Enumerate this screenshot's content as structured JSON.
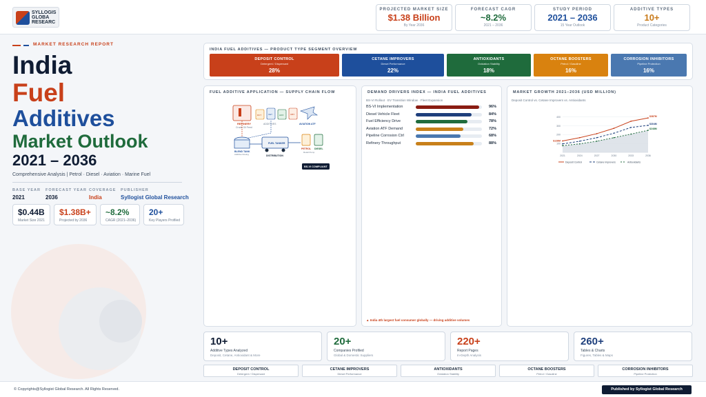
{
  "logo": {
    "line1": "SYLLOGIS",
    "line2": "GLOBA",
    "line3": "RESEARC"
  },
  "header_stats": [
    {
      "label": "PROJECTED MARKET SIZE",
      "value": "$1.38 Billion",
      "sub": "By Year 2036",
      "color": "#c8401a"
    },
    {
      "label": "FORECAST CAGR",
      "value": "~8.2%",
      "sub": "2021 – 2036",
      "color": "#1f6b3c"
    },
    {
      "label": "STUDY PERIOD",
      "value": "2021 – 2036",
      "sub": "15 Year Outlook",
      "color": "#1e4f9c"
    },
    {
      "label": "ADDITIVE TYPES",
      "value": "10+",
      "sub": "Product Categories",
      "color": "#c87a1a"
    }
  ],
  "hero": {
    "tag": "MARKET RESEARCH REPORT",
    "line1": "India",
    "line2": "Fuel",
    "line3": "Additives",
    "line4": "Market Outlook",
    "line5": "2021 – 2036",
    "subtitle": "Comprehensive Analysis  |  Petrol · Diesel · Aviation · Marine Fuel"
  },
  "meta": [
    {
      "label": "BASE YEAR",
      "value": "2021",
      "color": "#0f1c33"
    },
    {
      "label": "FORECAST YEAR",
      "value": "2036",
      "color": "#0f1c33"
    },
    {
      "label": "COVERAGE",
      "value": "India",
      "color": "#c8401a"
    },
    {
      "label": "PUBLISHER",
      "value": "Syllogist Global Research",
      "color": "#1e4f9c"
    }
  ],
  "mini_cards": [
    {
      "value": "$0.44B",
      "sub": "Market Size 2021",
      "color": "#0f1c33"
    },
    {
      "value": "$1.38B+",
      "sub": "Projected by 2036",
      "color": "#c8401a"
    },
    {
      "value": "~8.2%",
      "sub": "CAGR (2021–2036)",
      "color": "#1f6b3c"
    },
    {
      "value": "20+",
      "sub": "Key Players Profiled",
      "color": "#1e4f9c"
    }
  ],
  "segments": {
    "title": "INDIA FUEL ADDITIVES — PRODUCT TYPE SEGMENT OVERVIEW",
    "items": [
      {
        "name": "DEPOSIT CONTROL",
        "desc": "Detergent / Dispersant",
        "pct": "28%",
        "color": "#c8401a"
      },
      {
        "name": "CETANE IMPROVERS",
        "desc": "Diesel Performance",
        "pct": "22%",
        "color": "#1e4f9c"
      },
      {
        "name": "ANTIOXIDANTS",
        "desc": "Oxidation Stability",
        "pct": "18%",
        "color": "#1f6b3c"
      },
      {
        "name": "OCTANE BOOSTERS",
        "desc": "Petrol / Gasoline",
        "pct": "16%",
        "color": "#d9820f"
      },
      {
        "name": "CORROSION INHIBITORS",
        "desc": "Pipeline Protection",
        "pct": "16%",
        "color": "#4a78b0"
      }
    ]
  },
  "supply_chain": {
    "title": "FUEL ADDITIVE APPLICATION — SUPPLY CHAIN FLOW",
    "refinery": "REFINERY",
    "refinery_sub": "Crude Oil Feed",
    "additives": "ADDITIVES",
    "aviation": "AVIATION ATF",
    "blend": "BLEND TANK",
    "blend_sub": "Additive Dosing",
    "tanker": "FUEL TANKER",
    "distribution": "DISTRIBUTION",
    "petrol": "PETROL",
    "diesel": "DIESEL",
    "retail": "Retail Pump",
    "badge": "BS-VI COMPLIANT",
    "drums": [
      "DCT",
      "CET",
      "AOX",
      "OBT"
    ]
  },
  "drivers": {
    "title": "DEMAND DRIVERS INDEX — INDIA FUEL ADDITIVES",
    "sub": "BS-VI Rollout · EV Transition Window · Fleet Expansion",
    "items": [
      {
        "label": "BS-VI Implementation",
        "value": 96,
        "display": "96%",
        "color": "#8a1c12"
      },
      {
        "label": "Diesel Vehicle Fleet",
        "value": 84,
        "display": "84%",
        "color": "#1e3f7c"
      },
      {
        "label": "Fuel Efficiency Drive",
        "value": 78,
        "display": "78%",
        "color": "#1f6b3c"
      },
      {
        "label": "Aviation ATF Demand",
        "value": 72,
        "display": "72%",
        "color": "#c8801a"
      },
      {
        "label": "Pipeline Corrosion Ctrl",
        "value": 68,
        "display": "68%",
        "color": "#4a78b0"
      },
      {
        "label": "Refinery Throughput",
        "value": 88,
        "display": "88%",
        "color": "#c8801a"
      }
    ],
    "foot": "▲ India 4th largest fuel consumer globally — driving additive volumes"
  },
  "growth": {
    "title": "MARKET GROWTH 2021–2036 (USD MILLION)",
    "sub": "Deposit Control vs. Cetane Improvers vs. Antioxidants"
  },
  "chart_data": {
    "type": "line",
    "x": [
      2021,
      2024,
      2027,
      2030,
      2033,
      2036
    ],
    "x_labels": [
      "2021",
      "2024",
      "2027",
      "2030",
      "2033",
      "2036"
    ],
    "ylim": [
      0,
      450
    ],
    "y_ticks": [
      "100",
      "200",
      "300",
      "400"
    ],
    "start_label": "$128M",
    "series": [
      {
        "name": "Deposit Control",
        "values": [
          128,
          165,
          210,
          270,
          350,
          387
        ],
        "end_label": "$387M",
        "color": "#c8401a",
        "dash": ""
      },
      {
        "name": "Cetane Improvers",
        "values": [
          95,
          125,
          165,
          215,
          280,
          304
        ],
        "end_label": "$304M",
        "color": "#1e3f7c",
        "dash": "3,2"
      },
      {
        "name": "Antioxidants",
        "values": [
          75,
          95,
          125,
          165,
          205,
          248
        ],
        "end_label": "$248M",
        "color": "#1f6b3c",
        "dash": "2,2"
      }
    ]
  },
  "kpis": [
    {
      "value": "10+",
      "sub": "Additive Types Analyzed",
      "sub2": "Deposit, Cetane, Antioxidant & More",
      "color": "#0f1c33"
    },
    {
      "value": "20+",
      "sub": "Companies Profiled",
      "sub2": "Global & Domestic Suppliers",
      "color": "#1f6b3c"
    },
    {
      "value": "220+",
      "sub": "Report Pages",
      "sub2": "In-Depth Analysis",
      "color": "#c8401a"
    },
    {
      "value": "260+",
      "sub": "Tables & Charts",
      "sub2": "Figures, Tables & Maps",
      "color": "#1e3f7c"
    }
  ],
  "strip": [
    {
      "name": "DEPOSIT CONTROL",
      "desc": "Detergent / Dispersant"
    },
    {
      "name": "CETANE IMPROVERS",
      "desc": "Diesel Performance"
    },
    {
      "name": "ANTIOXIDANTS",
      "desc": "Oxidation Stability"
    },
    {
      "name": "OCTANE BOOSTERS",
      "desc": "Petrol / Gasoline"
    },
    {
      "name": "CORROSION INHIBITORS",
      "desc": "Pipeline Protection"
    }
  ],
  "footer": {
    "copyright": "© Copyrights@Syllogist Global Research. All Rights Reserved.",
    "publisher": "Published by Syllogist Global Research"
  }
}
